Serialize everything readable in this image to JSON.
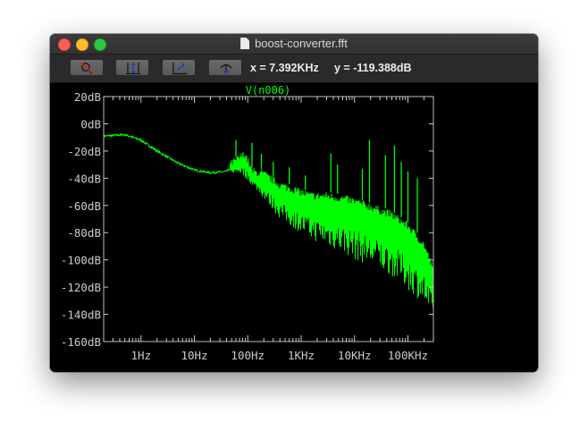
{
  "window": {
    "title": "boost-converter.fft"
  },
  "toolbar": {
    "buttons": [
      {
        "name": "zoom-cancel",
        "icon": "magnifier-cancel-icon"
      },
      {
        "name": "autorange-y",
        "icon": "autorange-y-icon"
      },
      {
        "name": "zoom-out",
        "icon": "zoom-out-icon"
      },
      {
        "name": "marker",
        "icon": "marker-icon"
      }
    ],
    "x_readout": "x = 7.392KHz",
    "y_readout": "y = -119.388dB"
  },
  "colors": {
    "trace": "#00ff00",
    "axes": "#cccccc",
    "background": "#000000"
  },
  "chart_data": {
    "type": "line",
    "series": [
      {
        "name": "V(n006)"
      }
    ],
    "x_scale": "log",
    "x_ticks": [
      "1Hz",
      "10Hz",
      "100Hz",
      "1KHz",
      "10KHz",
      "100KHz"
    ],
    "x_range_hz": [
      0.2,
      300000
    ],
    "y_ticks": [
      "20dB",
      "0dB",
      "-20dB",
      "-40dB",
      "-60dB",
      "-80dB",
      "-100dB",
      "-120dB",
      "-140dB",
      "-160dB"
    ],
    "ylim": [
      -160,
      20
    ],
    "grid": false,
    "x": [
      0.2,
      0.5,
      1,
      2,
      5,
      10,
      20,
      40,
      70,
      90,
      120,
      200,
      400,
      800,
      1500,
      3000,
      6000,
      10000,
      20000,
      50000,
      100000,
      200000,
      300000
    ],
    "y": [
      -9,
      -8,
      -12,
      -20,
      -29,
      -34,
      -36,
      -35,
      -28,
      -25,
      -38,
      -40,
      -48,
      -52,
      -56,
      -56,
      -58,
      -60,
      -64,
      -70,
      -78,
      -92,
      -110
    ],
    "y_low": [
      -9,
      -8,
      -12,
      -20,
      -29,
      -34,
      -37,
      -36,
      -36,
      -40,
      -45,
      -55,
      -70,
      -78,
      -85,
      -90,
      -95,
      -100,
      -105,
      -112,
      -122,
      -132,
      -150
    ],
    "peaks": [
      {
        "x": 60,
        "y": -12
      },
      {
        "x": 120,
        "y": -14
      },
      {
        "x": 180,
        "y": -22
      },
      {
        "x": 300,
        "y": -28
      },
      {
        "x": 600,
        "y": -32
      },
      {
        "x": 1200,
        "y": -38
      },
      {
        "x": 3600,
        "y": -22
      },
      {
        "x": 4800,
        "y": -30
      },
      {
        "x": 14000,
        "y": -33
      },
      {
        "x": 19000,
        "y": -12
      },
      {
        "x": 38000,
        "y": -23
      },
      {
        "x": 56000,
        "y": -16
      },
      {
        "x": 75000,
        "y": -28
      },
      {
        "x": 100000,
        "y": -35
      },
      {
        "x": 150000,
        "y": -40
      }
    ]
  }
}
